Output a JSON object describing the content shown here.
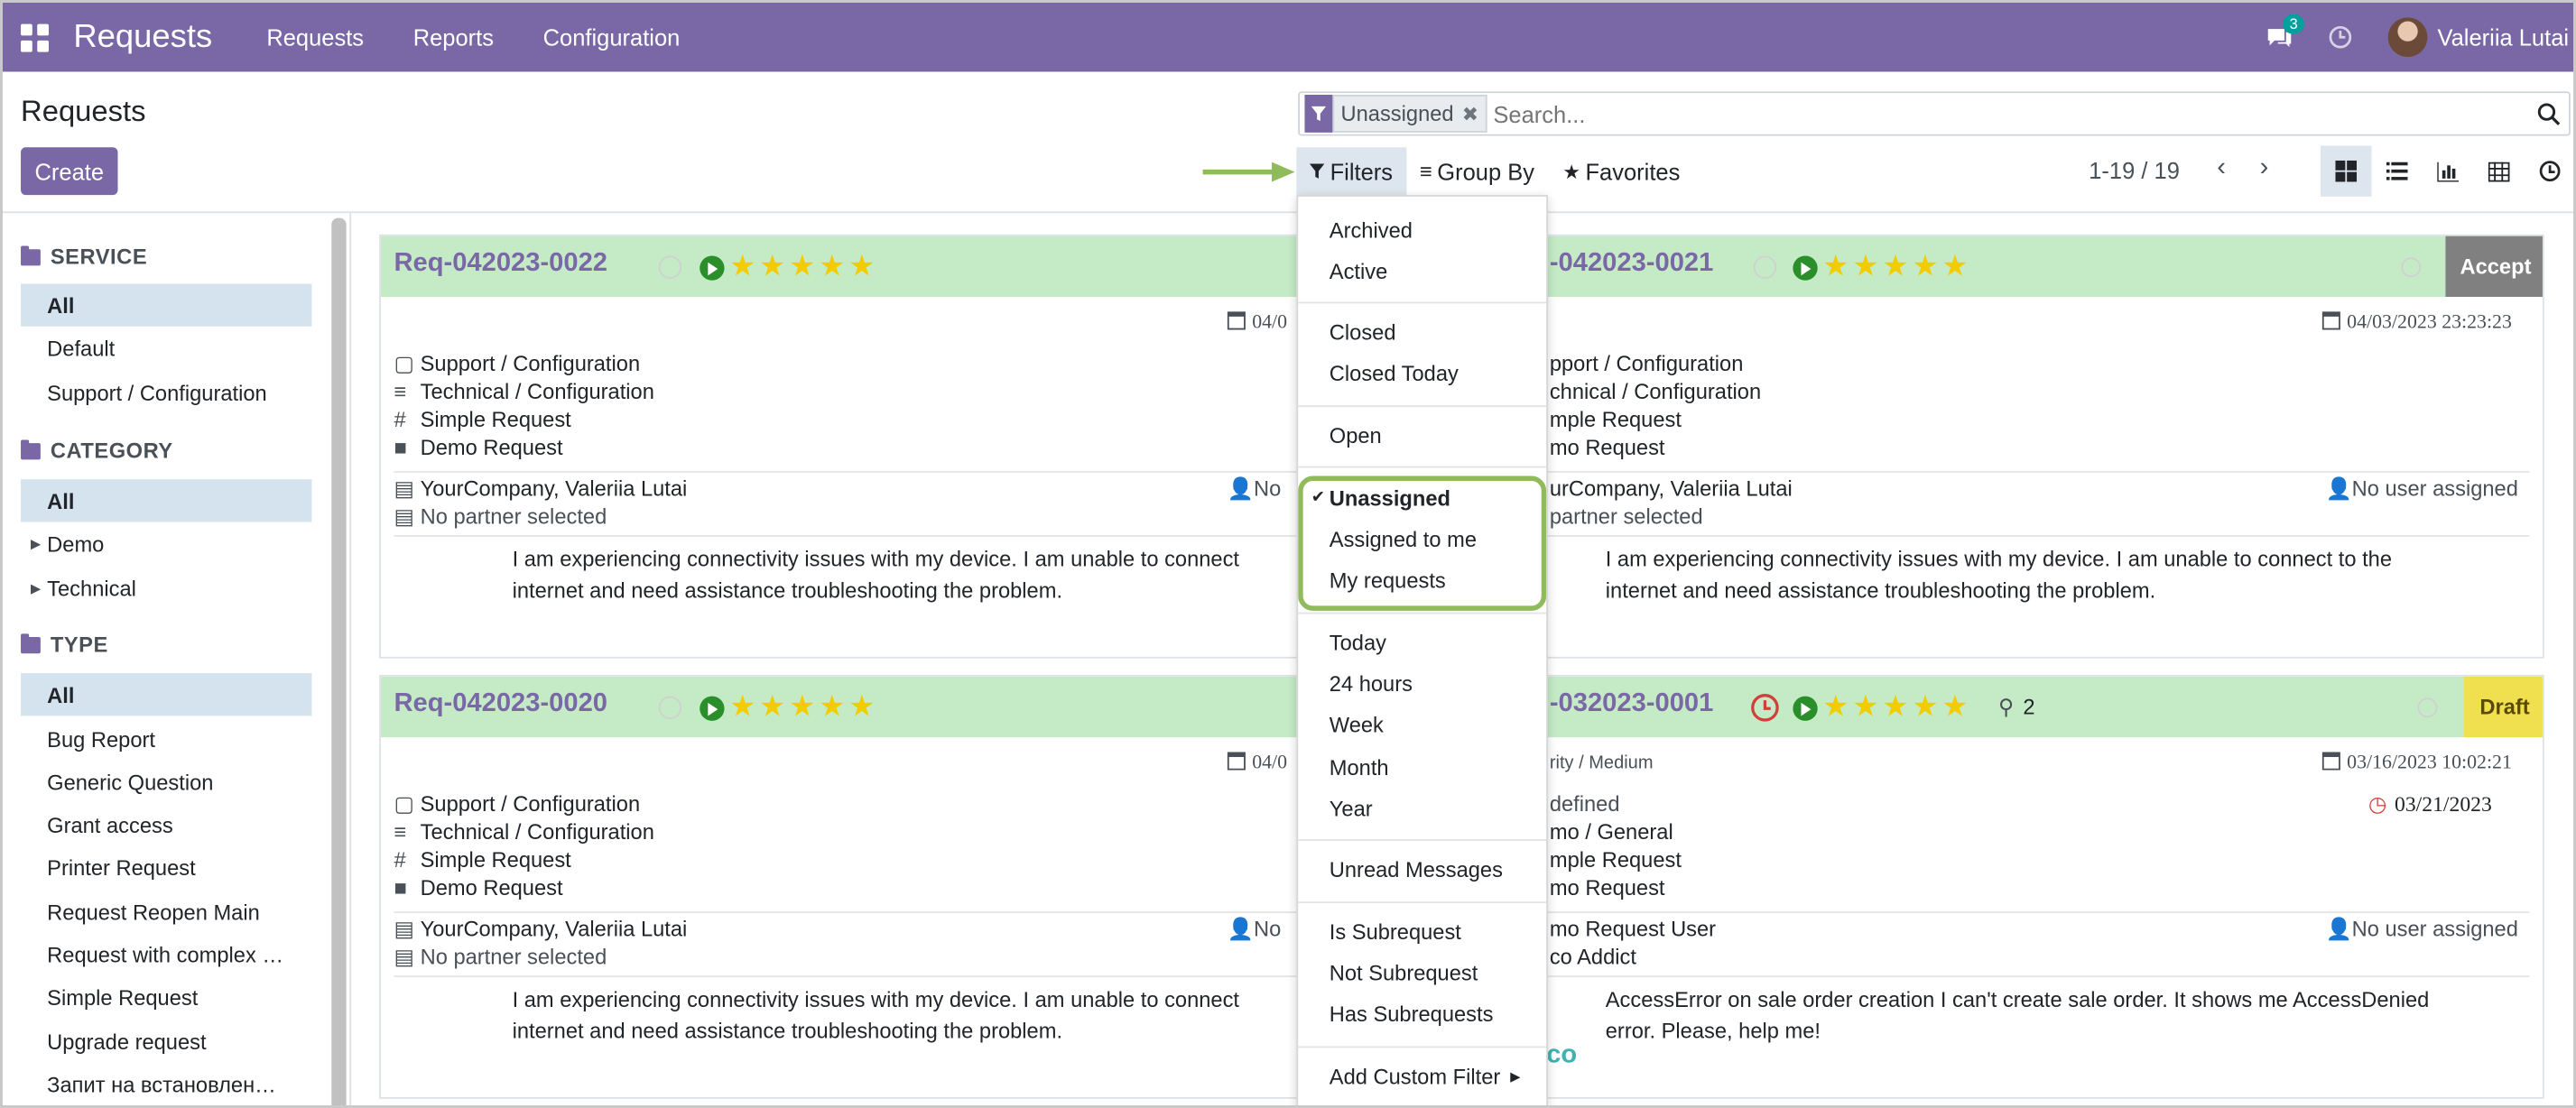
{
  "navbar": {
    "app_title": "Requests",
    "menus": [
      "Requests",
      "Reports",
      "Configuration"
    ],
    "chat_badge": "3",
    "username": "Valeriia Lutai"
  },
  "control": {
    "page_title": "Requests",
    "create_label": "Create",
    "facet_label": "Unassigned",
    "search_placeholder": "Search...",
    "filters_label": "Filters",
    "groupby_label": "Group By",
    "favorites_label": "Favorites",
    "pager": "1-19 / 19"
  },
  "sidebar": {
    "service_title": "SERVICE",
    "service_items": [
      "All",
      "Default",
      "Support / Configuration"
    ],
    "category_title": "CATEGORY",
    "category_items": [
      "All",
      "Demo",
      "Technical"
    ],
    "type_title": "TYPE",
    "type_items": [
      "All",
      "Bug Report",
      "Generic Question",
      "Grant access",
      "Printer Request",
      "Request Reopen Main",
      "Request with complex …",
      "Simple Request",
      "Upgrade request",
      "Запит на встановлен…"
    ]
  },
  "cards": [
    {
      "title": "Req-042023-0022",
      "stars": "★★★★★",
      "date": "04/0",
      "service": "Support / Configuration",
      "category": "Technical / Configuration",
      "type": "Simple Request",
      "stage": "Demo Request",
      "partner": "YourCompany, Valeriia Lutai",
      "no_partner": "No partner selected",
      "user": "No",
      "desc1": "I am experiencing connectivity issues with my device. I am unable to connect",
      "desc2": "internet and need assistance troubleshooting the problem."
    },
    {
      "title": "-042023-0021",
      "stars": "★★★★★",
      "button": "Accept",
      "date": "04/03/2023 23:23:23",
      "service": "pport / Configuration",
      "category": "chnical / Configuration",
      "type": "mple Request",
      "stage": "mo Request",
      "partner": "urCompany, Valeriia Lutai",
      "no_partner": "partner selected",
      "user": "No user assigned",
      "desc1": "I am experiencing connectivity issues with my device. I am unable to connect to the",
      "desc2": "internet and need assistance troubleshooting the problem."
    },
    {
      "title": "Req-042023-0020",
      "stars": "★★★★★",
      "date": "04/0",
      "service": "Support / Configuration",
      "category": "Technical / Configuration",
      "type": "Simple Request",
      "stage": "Demo Request",
      "partner": "YourCompany, Valeriia Lutai",
      "no_partner": "No partner selected",
      "user": "No",
      "desc1": "I am experiencing connectivity issues with my device. I am unable to connect",
      "desc2": "internet and need assistance troubleshooting the problem."
    },
    {
      "title": "-032023-0001",
      "stars": "★★★★★",
      "subcount": "2",
      "button": "Draft",
      "priority": "rity / Medium",
      "date": "03/16/2023 10:02:21",
      "deadline": "03/21/2023",
      "service": "defined",
      "category": "mo / General",
      "type": "mple Request",
      "stage": "mo Request",
      "partner": "mo Request User",
      "no_partner": "co Addict",
      "user": "No user assigned",
      "desc1": "AccessError on sale order creation I can't create sale order. It shows me AccessDenied",
      "desc2": "error. Please, help me!"
    }
  ],
  "filters_menu": {
    "items": [
      "Archived",
      "Active",
      "Closed",
      "Closed Today",
      "Open",
      "Unassigned",
      "Assigned to me",
      "My requests",
      "Today",
      "24 hours",
      "Week",
      "Month",
      "Year",
      "Unread Messages",
      "Is Subrequest",
      "Not Subrequest",
      "Has Subrequests",
      "Add Custom Filter"
    ],
    "checked": "Unassigned"
  },
  "logo_fragment": "co",
  "colors": {
    "brand": "#7a68a6",
    "card_header": "#c5ebc6",
    "accept": "#808080",
    "draft": "#f0e050",
    "highlight": "#8fbb5a"
  }
}
